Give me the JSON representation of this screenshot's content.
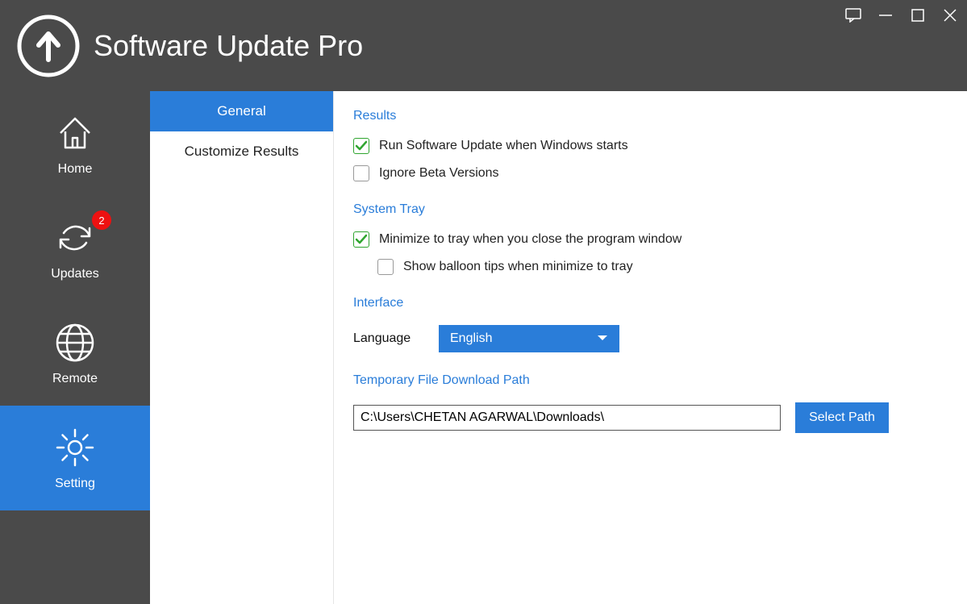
{
  "app": {
    "title": "Software Update Pro"
  },
  "nav": {
    "items": [
      {
        "label": "Home"
      },
      {
        "label": "Updates",
        "badge": "2"
      },
      {
        "label": "Remote"
      },
      {
        "label": "Setting"
      }
    ]
  },
  "subTabs": {
    "items": [
      {
        "label": "General"
      },
      {
        "label": "Customize Results"
      }
    ]
  },
  "sections": {
    "results": {
      "heading": "Results",
      "runOnStartup": "Run Software Update when Windows starts",
      "ignoreBeta": "Ignore Beta Versions"
    },
    "systemTray": {
      "heading": "System Tray",
      "minimize": "Minimize to tray when you close the program window",
      "balloon": "Show balloon tips when minimize to tray"
    },
    "interface": {
      "heading": "Interface",
      "languageLabel": "Language",
      "languageValue": "English"
    },
    "path": {
      "heading": "Temporary File Download Path",
      "value": "C:\\Users\\CHETAN AGARWAL\\Downloads\\",
      "button": "Select Path"
    }
  }
}
